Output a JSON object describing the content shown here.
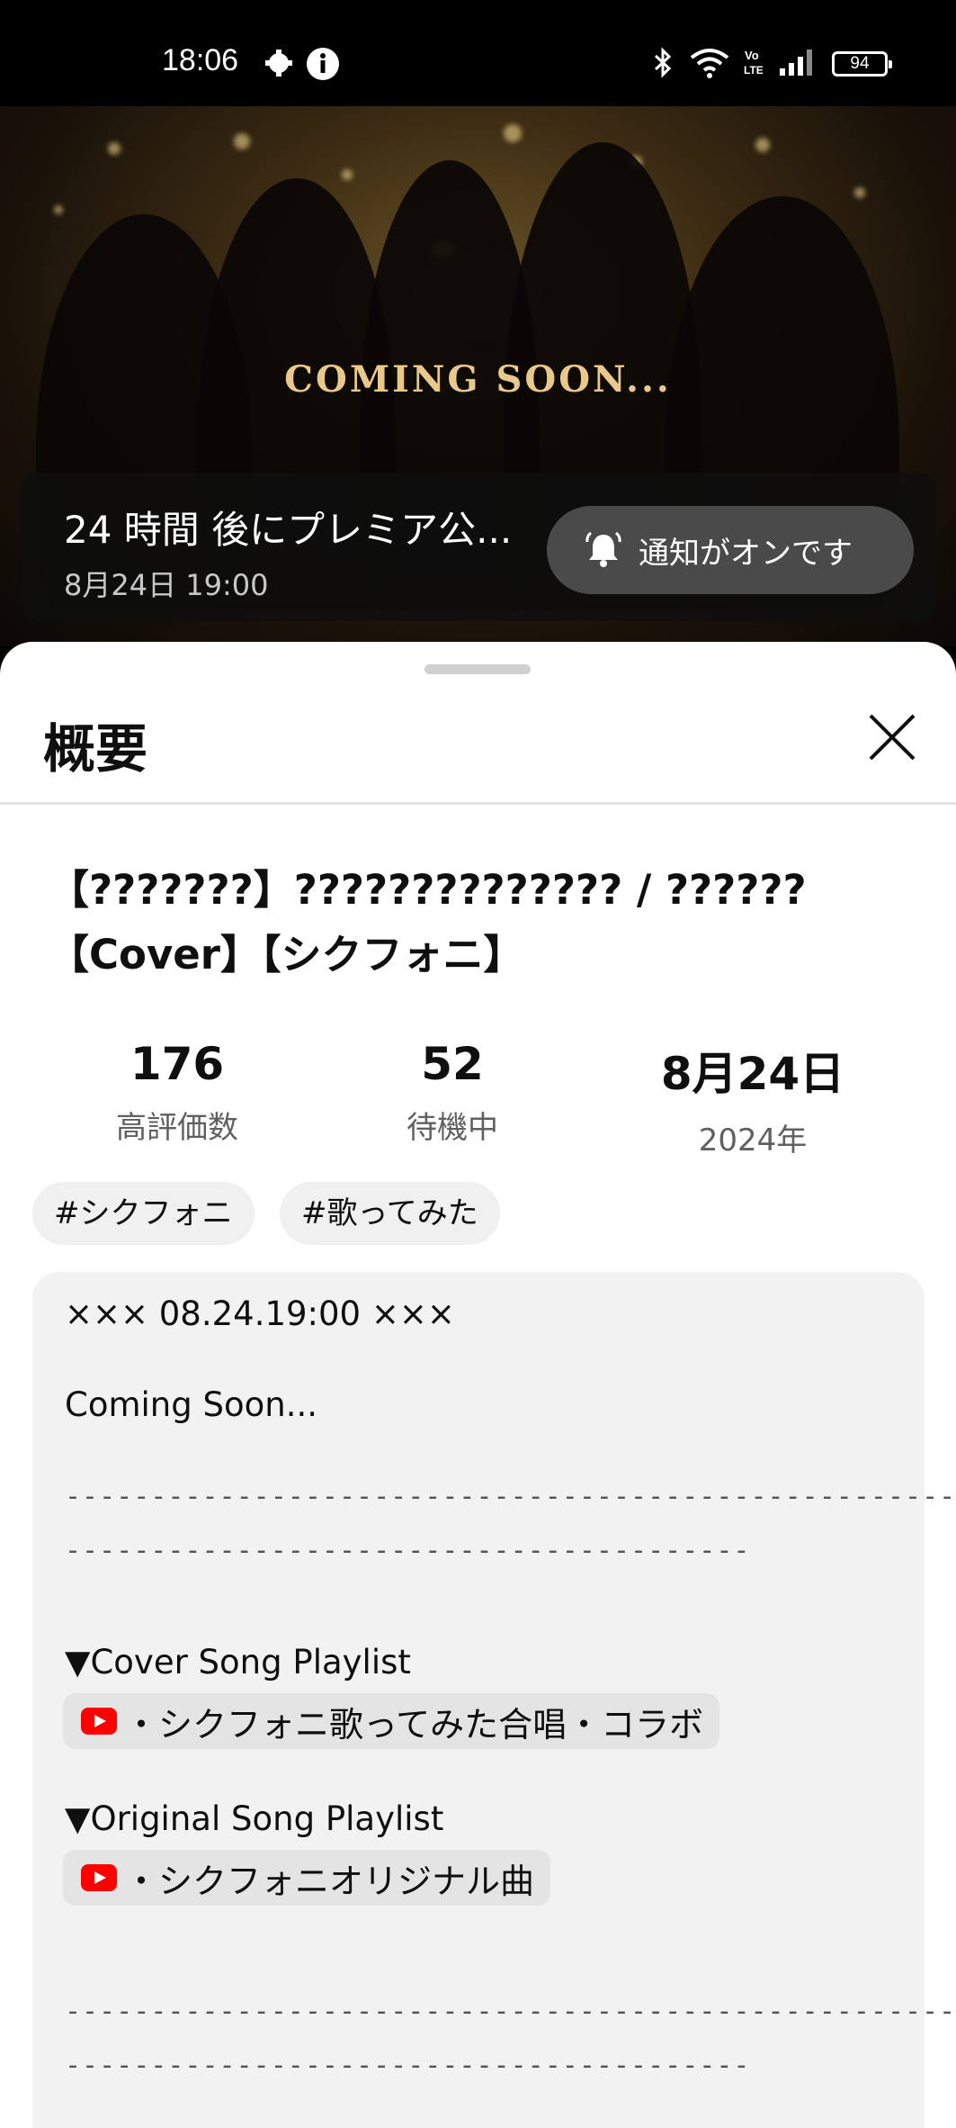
{
  "status_bar": {
    "time": "18:06",
    "battery": "94"
  },
  "video": {
    "overlay_text": "COMING SOON...",
    "premiere_title": "24 時間 後にプレミア公...",
    "premiere_date": "8月24日 19:00",
    "notify_label": "通知がオンです"
  },
  "sheet": {
    "title": "概要",
    "video_title": "【???????】?????????????? / ??????【Cover】【シクフォニ】",
    "stats": [
      {
        "value": "176",
        "label": "高評価数"
      },
      {
        "value": "52",
        "label": "待機中"
      },
      {
        "value": "8月24日",
        "label": "2024年"
      }
    ],
    "tags": [
      "#シクフォニ",
      "#歌ってみた"
    ],
    "description": {
      "line1": "××× 08.24.19:00 ×××",
      "line2": "Coming Soon...",
      "dashes_long": "------------------------------------------------------------",
      "dashes_short": "----------------------------------------",
      "cover_heading": "▼Cover Song Playlist",
      "cover_playlist": "・シクフォニ歌ってみた合唱・コラボ",
      "original_heading": "▼Original Song Playlist",
      "original_playlist": "・シクフォニオリジナル曲"
    }
  },
  "colors": {
    "accent": "#ff0000",
    "sheet_bg": "#ffffff",
    "desc_bg": "#f2f2f2"
  }
}
